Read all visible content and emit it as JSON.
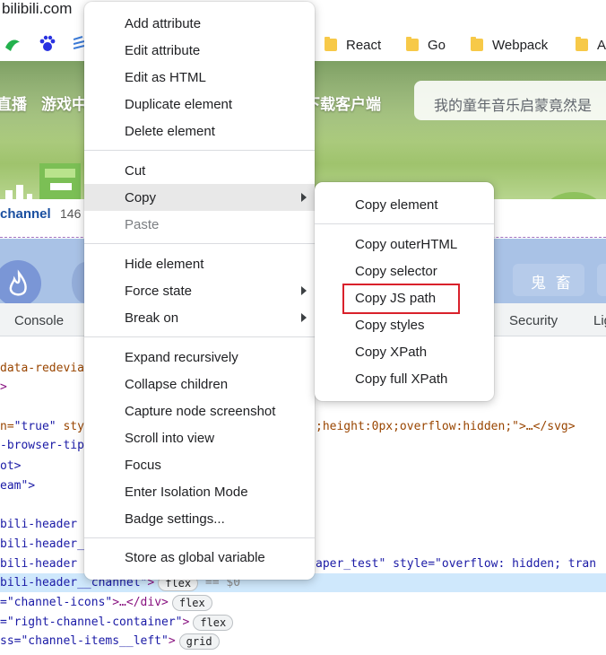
{
  "browser": {
    "url": "bilibili.com",
    "bookmarks": [
      {
        "label": "React"
      },
      {
        "label": "Go"
      },
      {
        "label": "Webpack"
      },
      {
        "label": "A"
      }
    ]
  },
  "page": {
    "nav": [
      "直播",
      "游戏中",
      "下载客户端"
    ],
    "search_placeholder": "我的童年音乐启蒙竟然是",
    "channel_label": "channel",
    "channel_count": "146",
    "ghost_label": "鬼 畜"
  },
  "devtools": {
    "tabs": [
      "Console",
      "Security",
      "Lig"
    ],
    "lines": [
      {
        "a": "data-redevia",
        "b": "",
        "c": ""
      },
      {
        "a": ">",
        "b": "",
        "c": ""
      },
      {
        "a": "n=",
        "b": "\"true\"",
        "c": " sty"
      },
      {
        "a": "-browser-tip",
        "b": "",
        "c": ""
      },
      {
        "a": "ot>",
        "b": "",
        "c": ""
      },
      {
        "a": "eam\">",
        "b": "",
        "c": ""
      },
      {
        "a": "",
        "b": "",
        "c": ""
      },
      {
        "a": "bili-header l",
        "b": "",
        "c": ""
      },
      {
        "a": " bili-header_",
        "b": "",
        "c": ""
      },
      {
        "a": " bili-header",
        "b": "",
        "c": ""
      },
      {
        "a": " bili-header__channel\"",
        "b": ">",
        "c": ""
      },
      {
        "a": "=\"channel-icons\"",
        "b": ">…</div>",
        "c": ""
      },
      {
        "a": "=\"right-channel-container\"",
        "b": ">",
        "c": ""
      },
      {
        "a": "ss=\"channel-items__left\"",
        "b": ">",
        "c": ""
      }
    ],
    "right_snippet_1": ";height:0px;overflow:hidden;\">…</svg>",
    "right_snippet_2": "aper_test\" style=\"overflow: hidden; tran",
    "eq_zero": "== $0",
    "pill_flex": "flex",
    "pill_grid": "grid"
  },
  "context_menu": {
    "items": [
      {
        "label": "Add attribute"
      },
      {
        "label": "Edit attribute"
      },
      {
        "label": "Edit as HTML"
      },
      {
        "label": "Duplicate element"
      },
      {
        "label": "Delete element"
      },
      {
        "label": "Cut"
      },
      {
        "label": "Copy"
      },
      {
        "label": "Paste"
      },
      {
        "label": "Hide element"
      },
      {
        "label": "Force state"
      },
      {
        "label": "Break on"
      },
      {
        "label": "Expand recursively"
      },
      {
        "label": "Collapse children"
      },
      {
        "label": "Capture node screenshot"
      },
      {
        "label": "Scroll into view"
      },
      {
        "label": "Focus"
      },
      {
        "label": "Enter Isolation Mode"
      },
      {
        "label": "Badge settings..."
      },
      {
        "label": "Store as global variable"
      }
    ]
  },
  "copy_submenu": {
    "items": [
      {
        "label": "Copy element"
      },
      {
        "label": "Copy outerHTML"
      },
      {
        "label": "Copy selector"
      },
      {
        "label": "Copy JS path"
      },
      {
        "label": "Copy styles"
      },
      {
        "label": "Copy XPath"
      },
      {
        "label": "Copy full XPath"
      }
    ]
  }
}
